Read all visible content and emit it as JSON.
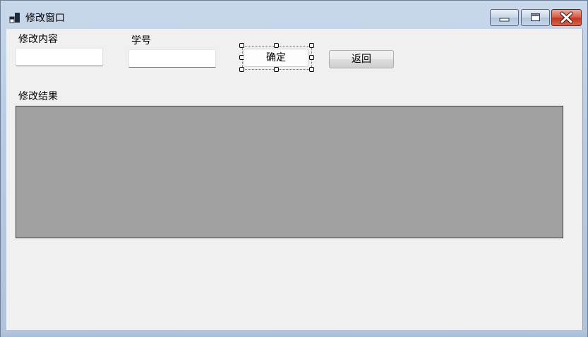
{
  "window": {
    "title": "修改窗口",
    "icon": "app-window-icon"
  },
  "caption_buttons": {
    "minimize_icon": "minimize-icon",
    "maximize_icon": "maximize-icon",
    "close_icon": "close-icon"
  },
  "form": {
    "content_label": "修改内容",
    "content_value": "",
    "student_id_label": "学号",
    "student_id_value": "",
    "confirm_label": "确定",
    "back_label": "返回",
    "result_label": "修改结果"
  },
  "colors": {
    "client_bg": "#f0f0f0",
    "grid_bg": "#a0a0a0",
    "close_red": "#c0371f"
  }
}
